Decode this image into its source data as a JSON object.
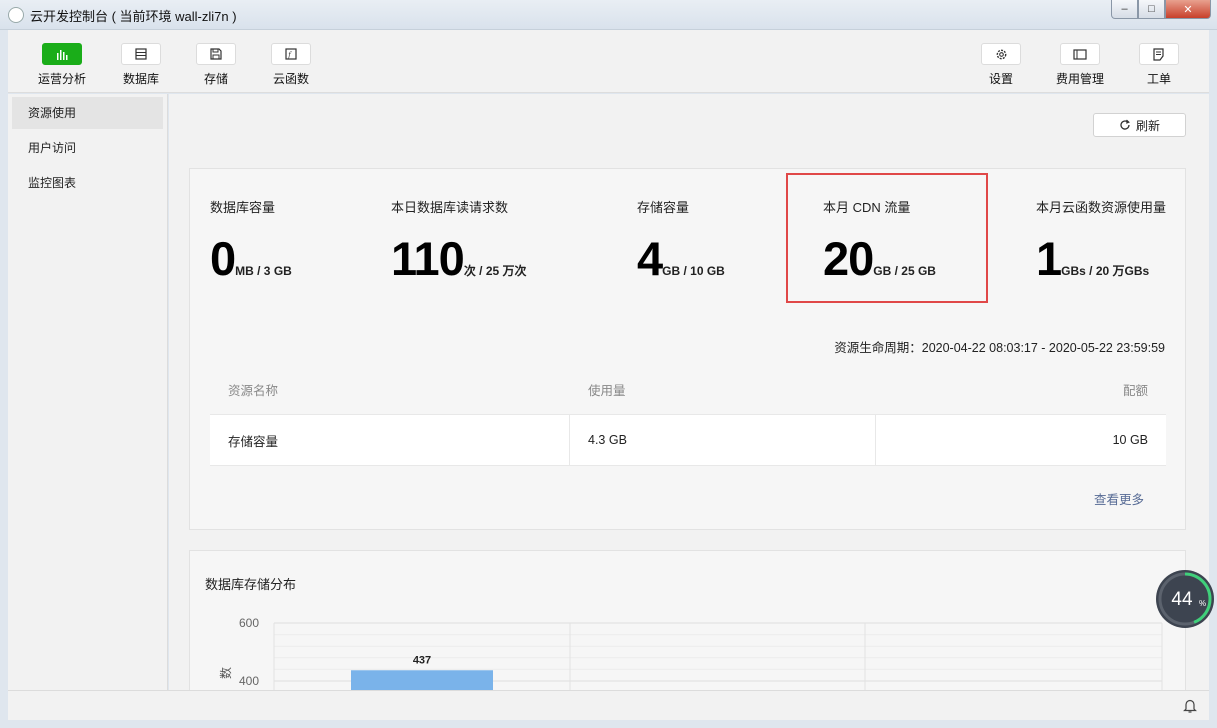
{
  "window": {
    "title": "云开发控制台 ( 当前环境 wall-zli7n )",
    "btn_minimize": "–",
    "btn_maximize": "□",
    "btn_close": "✕"
  },
  "toolbar": {
    "left": [
      {
        "label": "运营分析",
        "icon": "bar-chart-icon",
        "active": true
      },
      {
        "label": "数据库",
        "icon": "database-icon"
      },
      {
        "label": "存储",
        "icon": "storage-icon"
      },
      {
        "label": "云函数",
        "icon": "function-icon"
      }
    ],
    "right": [
      {
        "label": "设置",
        "icon": "gear-icon"
      },
      {
        "label": "费用管理",
        "icon": "billing-icon"
      },
      {
        "label": "工单",
        "icon": "ticket-icon"
      }
    ]
  },
  "sidebar": {
    "items": [
      {
        "label": "资源使用",
        "active": true
      },
      {
        "label": "用户访问"
      },
      {
        "label": "监控图表"
      }
    ]
  },
  "main": {
    "refresh_label": "刷新",
    "stats": [
      {
        "label": "数据库容量",
        "value": "0",
        "unit": "MB / 3 GB"
      },
      {
        "label": "本日数据库读请求数",
        "value": "110",
        "unit": "次 / 25 万次"
      },
      {
        "label": "存储容量",
        "value": "4",
        "unit": "GB / 10 GB"
      },
      {
        "label": "本月 CDN 流量",
        "value": "20",
        "unit": "GB / 25 GB"
      },
      {
        "label": "本月云函数资源使用量",
        "value": "1",
        "unit": "GBs / 20 万GBs"
      }
    ],
    "period": "资源生命周期：2020-04-22 08:03:17 - 2020-05-22 23:59:59",
    "table": {
      "headers": [
        "资源名称",
        "使用量",
        "配额"
      ],
      "rows": [
        [
          "存储容量",
          "4.3 GB",
          "10 GB"
        ]
      ]
    },
    "more_link": "查看更多"
  },
  "chart_panel": {
    "title": "数据库存储分布"
  },
  "chart_data": {
    "type": "bar",
    "title": "数据库存储分布",
    "ylabel": "数",
    "yticks": [
      600,
      400
    ],
    "ylim": [
      0,
      600
    ],
    "categories": [
      ""
    ],
    "values": [
      437
    ],
    "bar_color": "#7ab3ea"
  },
  "gauge": {
    "value": "44",
    "unit": "%",
    "fraction": 0.44
  },
  "colors": {
    "accent_green": "#1aad19",
    "highlight_red": "#e04848",
    "link_blue": "#576b95"
  }
}
